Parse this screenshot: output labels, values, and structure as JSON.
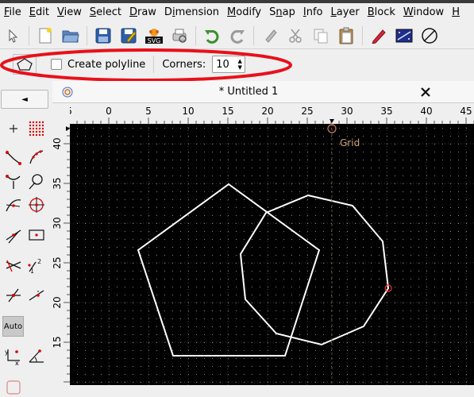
{
  "menu": {
    "items": [
      "File",
      "Edit",
      "View",
      "Select",
      "Draw",
      "Dimension",
      "Modify",
      "Snap",
      "Info",
      "Layer",
      "Block",
      "Window",
      "H"
    ],
    "underline": [
      "F",
      "E",
      "V",
      "S",
      "D",
      "i",
      "M",
      "n",
      "I",
      "L",
      "B",
      "W",
      "H"
    ]
  },
  "toolbar": {
    "icons": [
      "select-arrow-icon",
      "new-file-icon",
      "open-folder-icon",
      "save-icon",
      "save-as-icon",
      "svg-export-icon",
      "print-preview-icon",
      "undo-icon",
      "redo-icon",
      "eraser-icon",
      "cut-icon",
      "copy-icon",
      "paste-icon",
      "pen-icon",
      "grid-toggle-icon",
      "circle-slash-icon"
    ]
  },
  "options": {
    "create_polyline_label": "Create polyline",
    "create_polyline_checked": false,
    "corners_label": "Corners:",
    "corners_value": "10"
  },
  "document": {
    "title": "* Untitled 1"
  },
  "leftbar": {
    "back_symbol": "◄",
    "auto_label": "Auto"
  },
  "rulers": {
    "top_labels": [
      "5",
      "0",
      "5",
      "10",
      "15",
      "20",
      "25",
      "30",
      "35",
      "40",
      "45"
    ],
    "left_labels": [
      "40",
      "35",
      "30",
      "25",
      "20",
      "15"
    ]
  },
  "canvas": {
    "grid_label": "Grid",
    "background": "#000000",
    "grid_color": "#3c3c3c",
    "shape_color": "#ffffff",
    "snap_color": "#d08060",
    "marker_color": "#ff3030"
  },
  "colors": {
    "highlight": "#e8101a"
  }
}
